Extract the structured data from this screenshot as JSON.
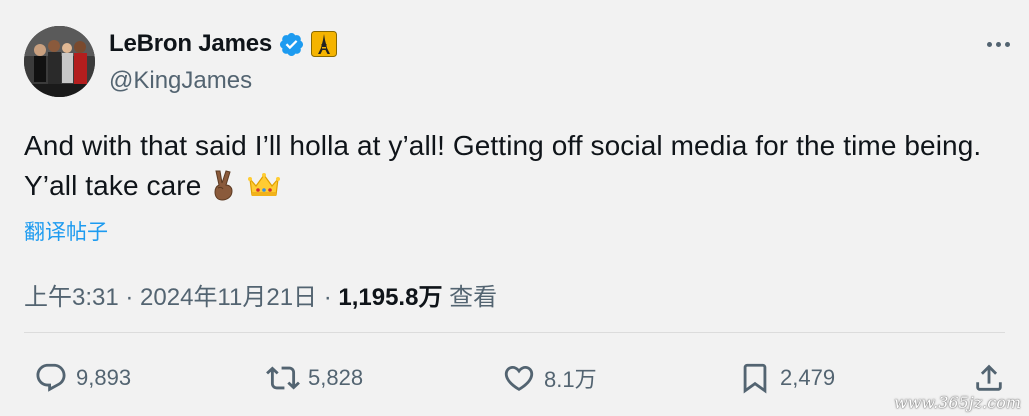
{
  "author": {
    "display_name": "LeBron James",
    "handle": "@KingJames"
  },
  "icons": {
    "verified": "verified-badge-icon",
    "affiliate": "eiffel-tower-badge-icon",
    "more": "more-dots-icon"
  },
  "tweet": {
    "text": "And with that said I’ll holla at y’all! Getting off social media for the time being. Y’all take care",
    "emojis": [
      "victory-hand-emoji",
      "crown-emoji"
    ],
    "translate_label": "翻译帖子"
  },
  "meta": {
    "time": "上午3:31",
    "sep1": " · ",
    "date": "2024年11月21日",
    "sep2": " · ",
    "views_count": "1,195.8万",
    "views_label": " 查看"
  },
  "actions": {
    "reply_count": "9,893",
    "retweet_count": "5,828",
    "like_count": "8.1万",
    "bookmark_count": "2,479"
  },
  "watermark": "www.365jz.com",
  "colors": {
    "background": "#f2f2f2",
    "text": "#0f1419",
    "secondary": "#536471",
    "link": "#1d9bf0",
    "verified": "#1d9bf0"
  }
}
